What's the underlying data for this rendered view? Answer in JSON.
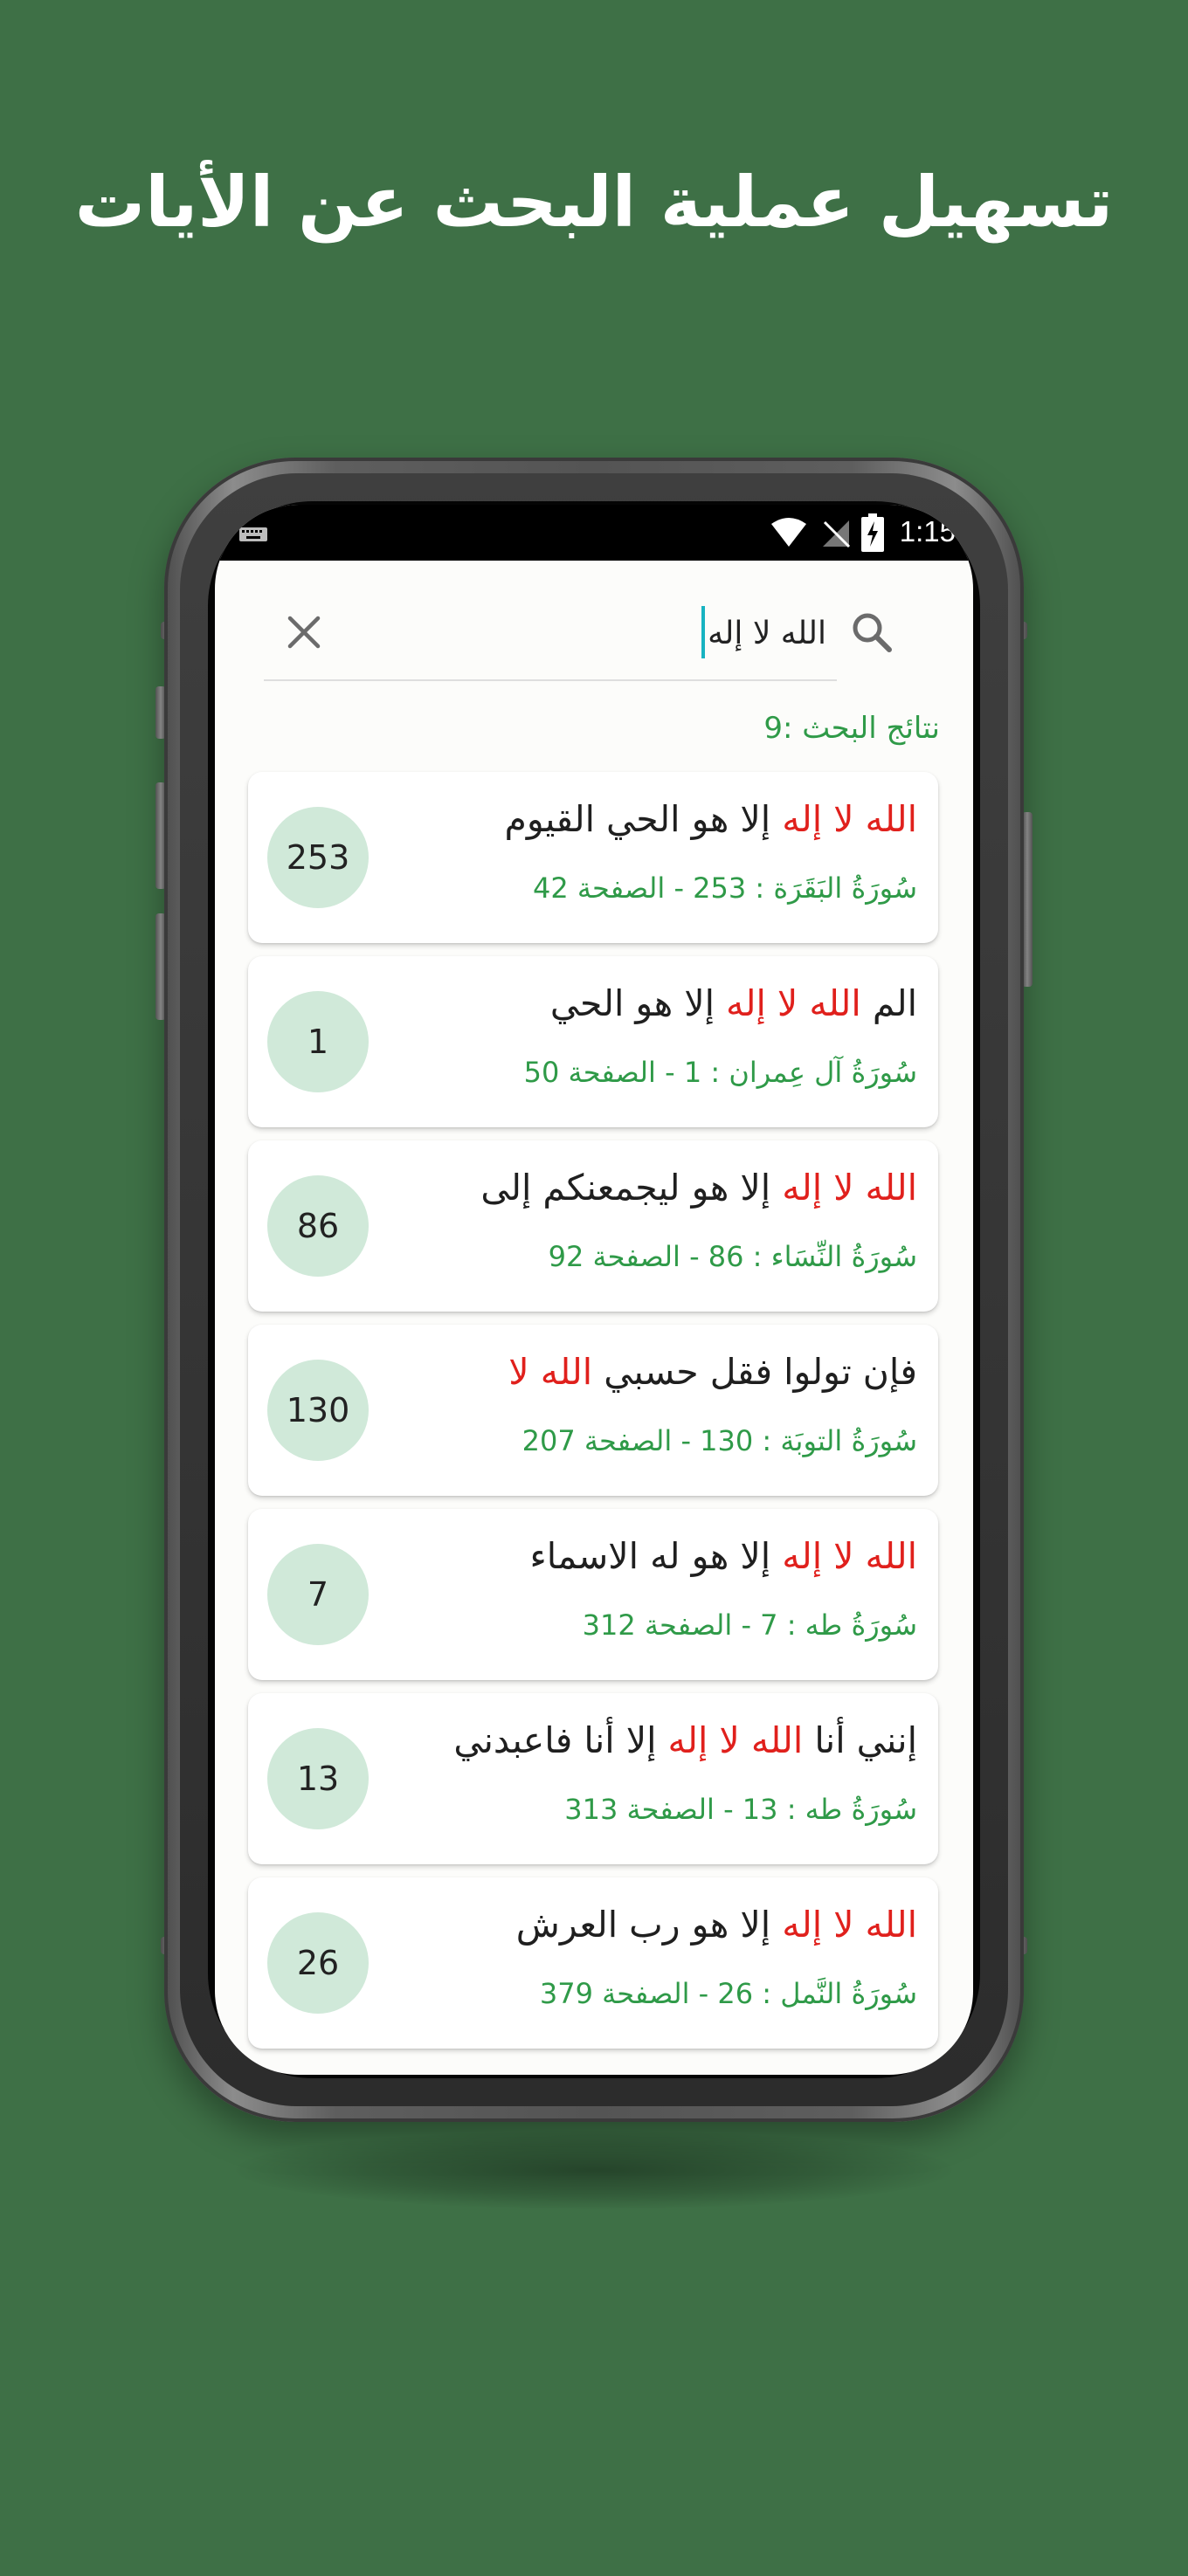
{
  "headline": "تسهيل عملية البحث عن الأيات",
  "status_bar": {
    "time": "1:15",
    "icons": [
      "keyboard-icon",
      "wifi-icon",
      "no-signal-icon",
      "battery-charging-icon"
    ]
  },
  "search": {
    "query": "الله لا إله",
    "icons": [
      "search-icon",
      "close-icon"
    ]
  },
  "results": {
    "count_label": "نتائج البحث :9",
    "items": [
      {
        "highlight": "الله لا إله",
        "text_after": " إلا هو الحي القيوم",
        "reference": "سُورَةُ البَقَرَة : 253 - الصفحة 42",
        "number": "253"
      },
      {
        "text_before": "الم ",
        "highlight": "الله لا إله",
        "text_after": " إلا هو الحي",
        "reference": "سُورَةُ آل عِمران : 1 - الصفحة 50",
        "number": "1"
      },
      {
        "highlight": "الله لا إله",
        "text_after": " إلا هو ليجمعنكم إلى",
        "reference": "سُورَةُ النِّسَاء : 86 - الصفحة 92",
        "number": "86"
      },
      {
        "text_before": "فإن تولوا فقل حسبي ",
        "highlight": "الله لا",
        "reference": "سُورَةُ التوبَة : 130 - الصفحة 207",
        "number": "130"
      },
      {
        "highlight": "الله لا إله",
        "text_after": " إلا هو له الاسماء",
        "reference": "سُورَةُ طه : 7 - الصفحة 312",
        "number": "7"
      },
      {
        "text_before": "إنني أنا ",
        "highlight": "الله لا إله",
        "text_after": " إلا أنا فاعبدني",
        "reference": "سُورَةُ طه : 13 - الصفحة 313",
        "number": "13"
      },
      {
        "highlight": "الله لا إله",
        "text_after": " إلا هو رب العرش",
        "reference": "سُورَةُ النَّمل : 26 - الصفحة 379",
        "number": "26"
      }
    ]
  },
  "colors": {
    "background": "#3e7046",
    "highlight": "#e0201c",
    "reference": "#2f9a48",
    "badge": "#d0e9d9",
    "caret": "#17b3c1"
  }
}
